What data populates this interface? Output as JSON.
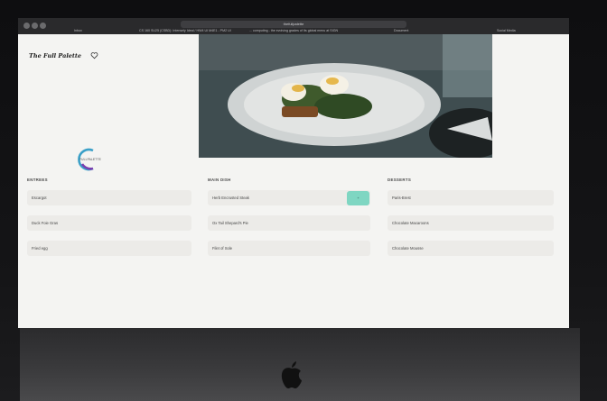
{
  "browser": {
    "url": "thefullpalette",
    "tabs": [
      "Inbox",
      "CS 160 SU25 (CSBD): Intensely Ideal / HW4 UI M4E1 - PM2 UI",
      "... computing - the evolving grades of Its global menu at SIGN",
      "Document",
      "Social Media"
    ]
  },
  "app": {
    "brand": "The Full Palette",
    "logo_text": "FULLPALETTE"
  },
  "menu": {
    "columns": [
      {
        "heading": "ENTREES",
        "items": [
          "Escargot",
          "Duck Foie Gras",
          "Fried egg"
        ]
      },
      {
        "heading": "MAIN DISH",
        "items": [
          "Herb Encrusted Steak",
          "Ox Tail Shepard's Pie",
          "Filet of Sole"
        ]
      },
      {
        "heading": "DESSERTS",
        "items": [
          "Paris-Brest",
          "Chocolate Macaroons",
          "Chocolate Mousse"
        ]
      }
    ],
    "add_button_label": "+"
  },
  "colors": {
    "accent_teal": "#7fd6c2",
    "accent_purple": "#b040d0",
    "logo_blue": "#3aa0c8",
    "logo_purple": "#7a3fb0"
  },
  "icons": {
    "favorite": "heart-icon",
    "device_logo": "apple-icon"
  }
}
